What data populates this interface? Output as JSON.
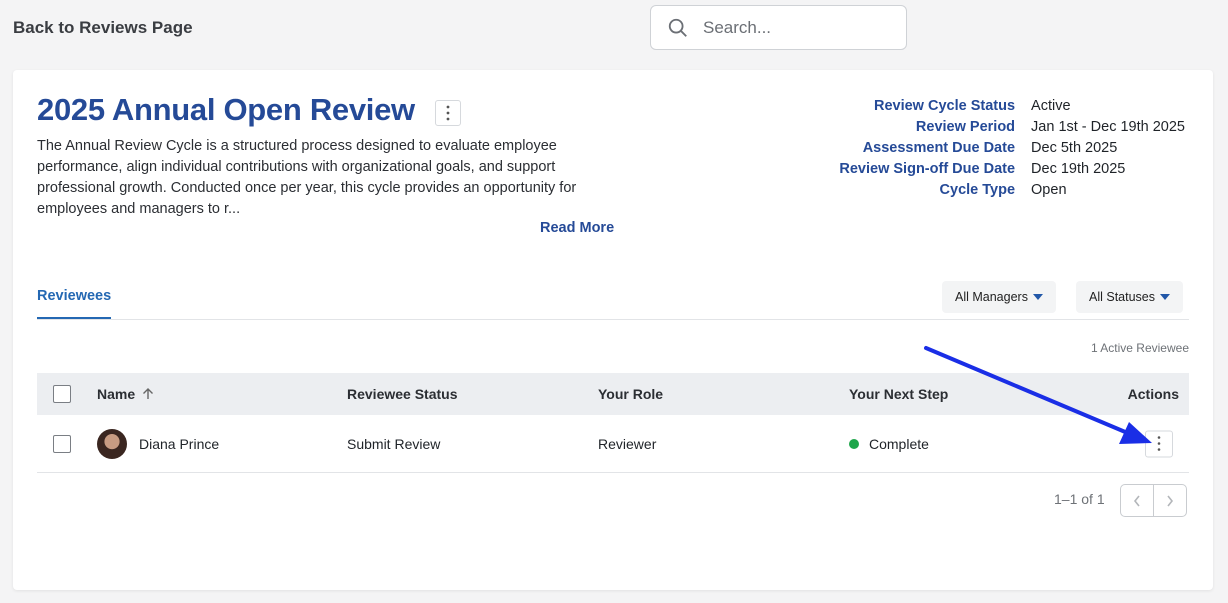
{
  "header": {
    "back_label": "Back to Reviews Page",
    "search_placeholder": "Search..."
  },
  "review": {
    "title": "2025 Annual Open Review",
    "description": "The Annual Review Cycle is a structured process designed to evaluate employee performance, align individual contributions with organizational goals, and support professional growth. Conducted once per year, this cycle provides an opportunity for employees and managers to r...",
    "read_more": "Read More"
  },
  "meta": [
    {
      "label": "Review Cycle Status",
      "value": "Active"
    },
    {
      "label": "Review Period",
      "value": "Jan 1st - Dec 19th 2025"
    },
    {
      "label": "Assessment Due Date",
      "value": "Dec 5th 2025"
    },
    {
      "label": "Review Sign-off Due Date",
      "value": "Dec 19th 2025"
    },
    {
      "label": "Cycle Type",
      "value": "Open"
    }
  ],
  "tabs": {
    "active": "Reviewees"
  },
  "filters": {
    "managers": "All Managers",
    "statuses": "All Statuses"
  },
  "active_count": "1 Active Reviewee",
  "table": {
    "columns": [
      "Name",
      "Reviewee Status",
      "Your Role",
      "Your Next Step",
      "Actions"
    ],
    "rows": [
      {
        "name": "Diana Prince",
        "status": "Submit Review",
        "role": "Reviewer",
        "next_step": "Complete"
      }
    ]
  },
  "pagination": {
    "text": "1–1 of 1"
  },
  "colors": {
    "accent": "#254a97",
    "tab": "#2468b3",
    "status_complete": "#1ea54a",
    "annotation_arrow": "#1a2ee6"
  }
}
